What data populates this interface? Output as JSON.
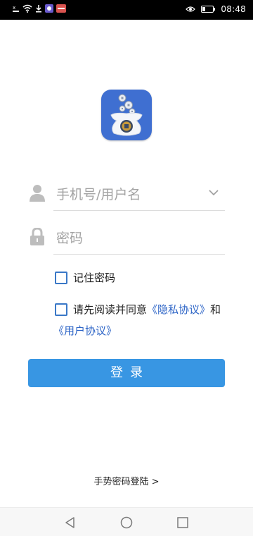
{
  "status_bar": {
    "time": "08:48",
    "icons": [
      "wifi-icon",
      "download-icon",
      "app-notification-icon",
      "app-notification-icon-2",
      "eye-icon",
      "battery-icon"
    ]
  },
  "app": {
    "icon": "money-bag-app-icon",
    "colors": {
      "icon_bg": "#3f6fd1",
      "accent": "#3896e3",
      "link": "#2b63c6"
    }
  },
  "login_form": {
    "username_placeholder": "手机号/用户名",
    "password_placeholder": "密码",
    "remember_password_label": "记住密码",
    "agreement_prefix": "请先阅读并同意",
    "privacy_policy_link": "《隐私协议》",
    "agreement_and": "和",
    "user_agreement_link": "《用户协议》",
    "login_button": "登录",
    "gesture_login_link": "手势密码登陆 >"
  },
  "nav_bar": {
    "icons": [
      "back-icon",
      "home-icon",
      "recents-icon"
    ]
  }
}
